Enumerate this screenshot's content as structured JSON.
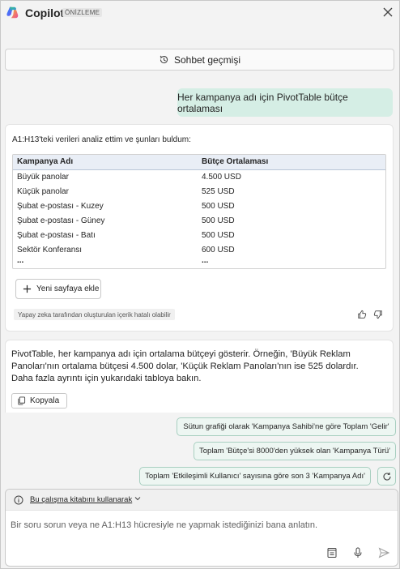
{
  "header": {
    "title": "Copilot",
    "badge": "ÖNİZLEME"
  },
  "history": {
    "label": "Sohbet geçmişi"
  },
  "user_message": "Her kampanya adı için PivotTable bütçe ortalaması",
  "response": {
    "intro": "A1:H13'teki verileri analiz ettim ve şunları buldum:",
    "table": {
      "headers": [
        "Kampanya Adı",
        "Bütçe Ortalaması"
      ],
      "rows": [
        [
          "Büyük panolar",
          "4.500 USD"
        ],
        [
          "Küçük panolar",
          "525 USD"
        ],
        [
          "Şubat e-postası - Kuzey",
          "500 USD"
        ],
        [
          "Şubat e-postası - Güney",
          "500 USD"
        ],
        [
          "Şubat e-postası - Batı",
          "500 USD"
        ],
        [
          "Sektör Konferansı",
          "600 USD"
        ]
      ],
      "ellipsis": [
        "...",
        "..."
      ]
    },
    "new_sheet_label": "Yeni sayfaya ekle",
    "ai_note": "Yapay zeka tarafından oluşturulan içerik hatalı olabilir"
  },
  "summary": {
    "text": "PivotTable, her kampanya adı için ortalama bütçeyi gösterir. Örneğin, 'Büyük Reklam Panoları'nın ortalama bütçesi 4.500 dolar, 'Küçük Reklam Panoları'nın ise 525 dolardır. Daha fazla ayrıntı için yukarıdaki tabloya bakın.",
    "copy_label": "Kopyala"
  },
  "suggestions": [
    "Sütun grafiği olarak 'Kampanya Sahibi'ne göre Toplam 'Gelir'",
    "Toplam 'Bütçe'si 8000'den yüksek olan 'Kampanya Türü'",
    "Toplam 'Etkileşimli Kullanıcı' sayısına göre son 3 'Kampanya Adı'"
  ],
  "input": {
    "context_label": "Bu çalışma kitabını kullanarak",
    "placeholder": "Bir soru sorun veya ne A1:H13 hücresiyle ne yapmak istediğinizi bana anlatın."
  },
  "colors": {
    "accent_green": "#d5eee5",
    "chip_border": "#a8cfc0",
    "table_header": "#e9eef6"
  }
}
